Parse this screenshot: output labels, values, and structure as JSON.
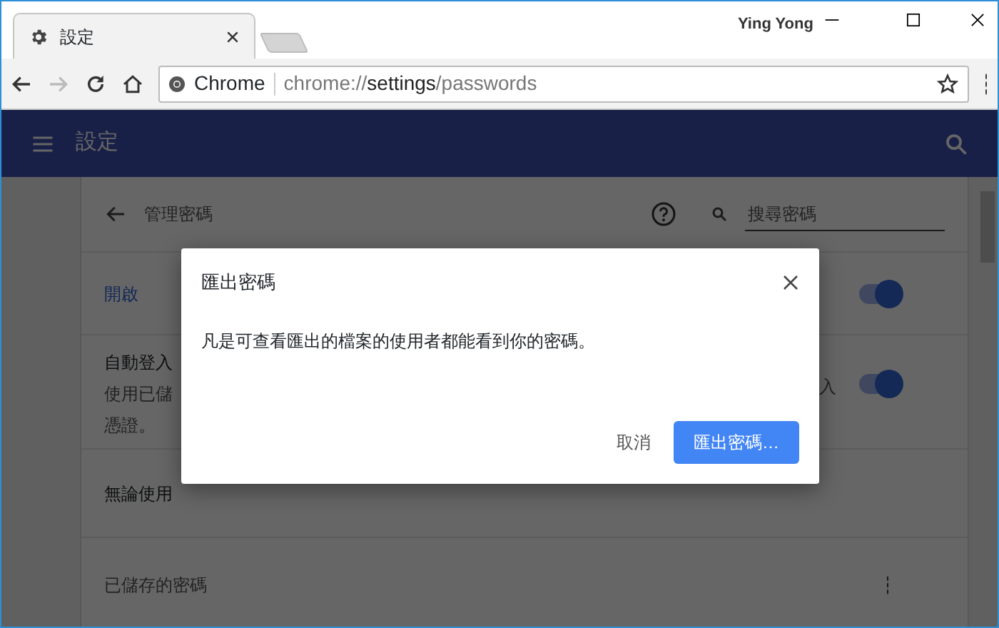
{
  "browser": {
    "tab": {
      "title": "設定",
      "selected": true
    },
    "profile": "Ying Yong",
    "omnibox": {
      "site_label": "Chrome",
      "url": {
        "scheme": "chrome://",
        "host": "settings",
        "path": "/passwords"
      }
    }
  },
  "header": {
    "title": "設定"
  },
  "page": {
    "title": "管理密碼",
    "search_placeholder": "搜尋密碼"
  },
  "settings_rows": [
    {
      "kind": "toggle",
      "label": "開啟",
      "on": true
    },
    {
      "kind": "detail",
      "title": "自動登入",
      "description_lines": [
        "使用已儲",
        "憑證。"
      ],
      "trailing_fragment": "入",
      "on": true
    },
    {
      "kind": "text",
      "label": "無論使用"
    }
  ],
  "saved_passwords": {
    "title": "已儲存的密碼"
  },
  "dialog": {
    "title": "匯出密碼",
    "message": "凡是可查看匯出的檔案的使用者都能看到你的密碼。",
    "buttons": [
      {
        "kind": "text",
        "label": "取消"
      },
      {
        "kind": "primary",
        "label": "匯出密碼…"
      }
    ]
  }
}
